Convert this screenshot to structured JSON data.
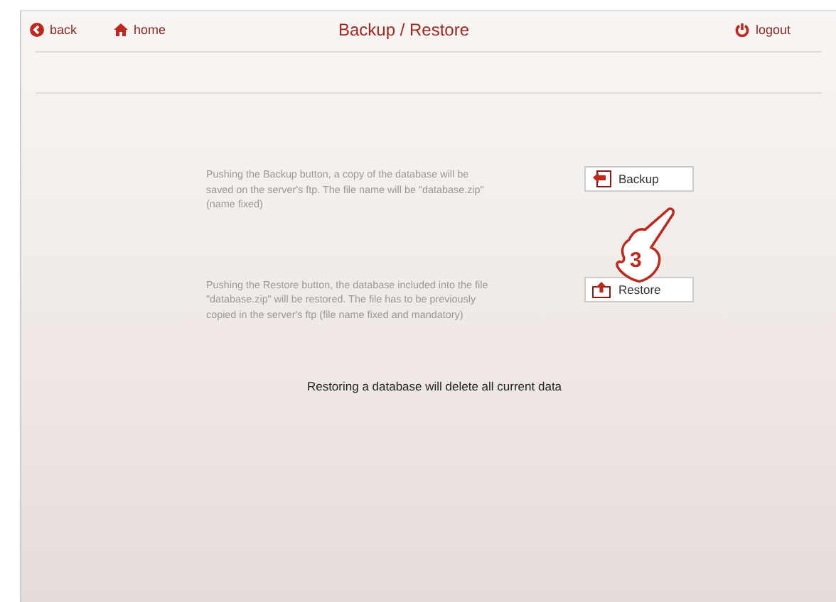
{
  "header": {
    "back": "back",
    "home": "home",
    "title": "Backup / Restore",
    "logout": "logout"
  },
  "actions": [
    {
      "kind": "backup",
      "description": "Pushing the Backup button, a copy of the database will be saved on the server's ftp. The file name will be \"database.zip\" (name fixed)",
      "button": "Backup"
    },
    {
      "kind": "restore",
      "description": "Pushing the Restore button, the database included into the file \"database.zip\" will be restored. The file has to be previously copied in the server's ftp (file name fixed and mandatory)",
      "button": "Restore"
    }
  ],
  "warning": "Restoring a database will delete all current data",
  "annotation": {
    "step": "3"
  }
}
